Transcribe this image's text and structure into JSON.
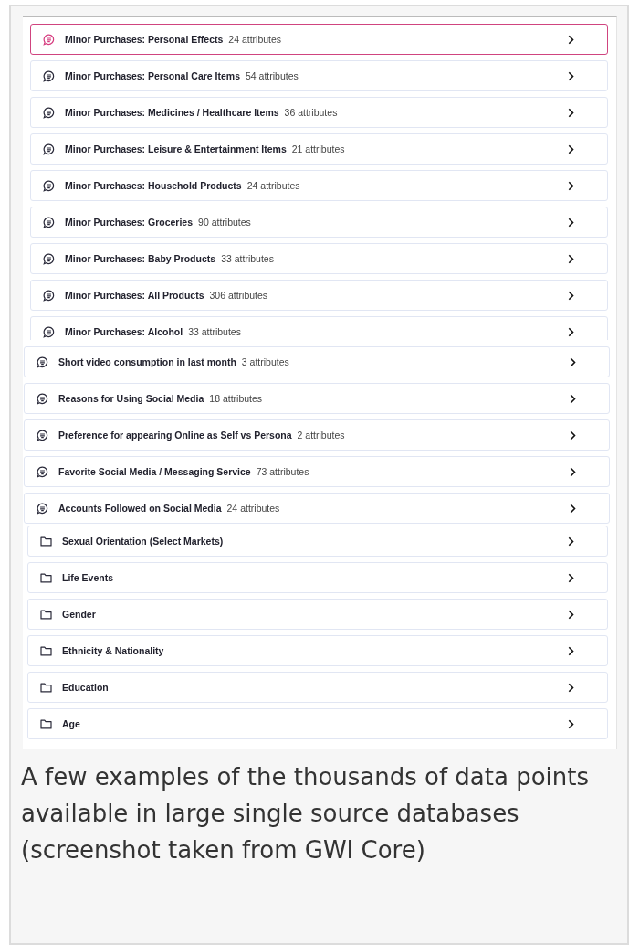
{
  "groups": [
    {
      "items": [
        {
          "kind": "question",
          "label": "Minor Purchases: Personal Effects",
          "count": "24 attributes",
          "selected": true
        },
        {
          "kind": "question",
          "label": "Minor Purchases: Personal Care Items",
          "count": "54 attributes",
          "selected": false
        },
        {
          "kind": "question",
          "label": "Minor Purchases: Medicines / Healthcare Items",
          "count": "36 attributes",
          "selected": false
        },
        {
          "kind": "question",
          "label": "Minor Purchases: Leisure & Entertainment Items",
          "count": "21 attributes",
          "selected": false
        },
        {
          "kind": "question",
          "label": "Minor Purchases: Household Products",
          "count": "24 attributes",
          "selected": false
        },
        {
          "kind": "question",
          "label": "Minor Purchases: Groceries",
          "count": "90 attributes",
          "selected": false
        },
        {
          "kind": "question",
          "label": "Minor Purchases: Baby Products",
          "count": "33 attributes",
          "selected": false
        },
        {
          "kind": "question",
          "label": "Minor Purchases: All Products",
          "count": "306 attributes",
          "selected": false
        },
        {
          "kind": "question",
          "label": "Minor Purchases: Alcohol",
          "count": "33 attributes",
          "selected": false
        }
      ]
    },
    {
      "items": [
        {
          "kind": "question",
          "label": "Short video consumption in last month",
          "count": "3 attributes",
          "selected": false
        },
        {
          "kind": "question",
          "label": "Reasons for Using Social Media",
          "count": "18 attributes",
          "selected": false
        },
        {
          "kind": "question",
          "label": "Preference for appearing Online as Self vs Persona",
          "count": "2 attributes",
          "selected": false
        },
        {
          "kind": "question",
          "label": "Favorite Social Media / Messaging Service",
          "count": "73 attributes",
          "selected": false
        },
        {
          "kind": "question",
          "label": "Accounts Followed on Social Media",
          "count": "24 attributes",
          "selected": false
        }
      ]
    },
    {
      "items": [
        {
          "kind": "folder",
          "label": "Sexual Orientation (Select Markets)",
          "selected": false
        },
        {
          "kind": "folder",
          "label": "Life Events",
          "selected": false
        },
        {
          "kind": "folder",
          "label": "Gender",
          "selected": false
        },
        {
          "kind": "folder",
          "label": "Ethnicity & Nationality",
          "selected": false
        },
        {
          "kind": "folder",
          "label": "Education",
          "selected": false
        },
        {
          "kind": "folder",
          "label": "Age",
          "selected": false
        }
      ]
    }
  ],
  "caption": "A few examples of the thousands of data points available in large single source databases (screenshot taken from GWI Core)"
}
